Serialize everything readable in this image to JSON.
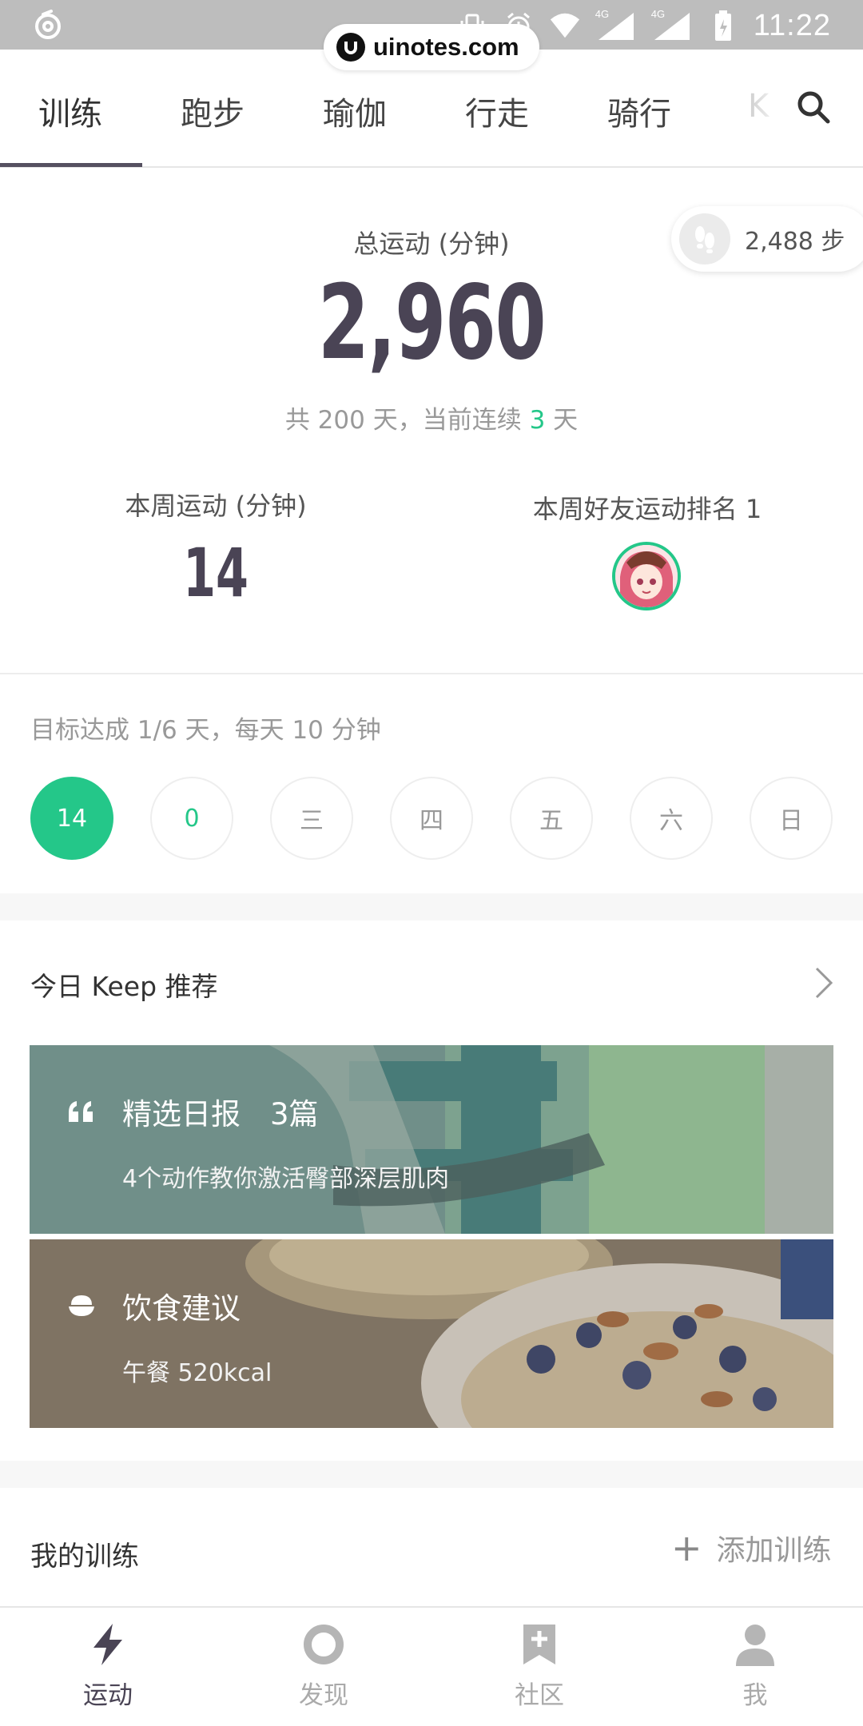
{
  "status_bar": {
    "time": "11:22",
    "network_1": "4G",
    "network_2": "4G"
  },
  "watermark": "uinotes.com",
  "tabs": [
    {
      "label": "训练"
    },
    {
      "label": "跑步"
    },
    {
      "label": "瑜伽"
    },
    {
      "label": "行走"
    },
    {
      "label": "骑行"
    },
    {
      "label": "K"
    }
  ],
  "summary": {
    "steps": "2,488 步",
    "total_label": "总运动 (分钟)",
    "total_value": "2,960",
    "total_days_pre": "共 200 天，当前连续 ",
    "streak_days": "3",
    "total_days_post": " 天",
    "week_label": "本周运动 (分钟)",
    "week_value": "14",
    "rank_label": "本周好友运动排名 1"
  },
  "goal": {
    "text": "目标达成 1/6 天，每天 10 分钟",
    "days": [
      "14",
      "0",
      "三",
      "四",
      "五",
      "六",
      "日"
    ]
  },
  "recommend": {
    "title": "今日 Keep 推荐",
    "cards": [
      {
        "icon": "quote-icon",
        "title": "精选日报　3篇",
        "subtitle": "4个动作教你激活臀部深层肌肉"
      },
      {
        "icon": "rice-bowl-icon",
        "title": "饮食建议",
        "subtitle": "午餐 520kcal"
      }
    ]
  },
  "my_training": {
    "title": "我的训练",
    "add_label": "添加训练"
  },
  "bottom_nav": [
    {
      "label": "运动"
    },
    {
      "label": "发现"
    },
    {
      "label": "社区"
    },
    {
      "label": "我"
    }
  ],
  "colors": {
    "accent": "#24c789",
    "numbers": "#4a4455"
  }
}
